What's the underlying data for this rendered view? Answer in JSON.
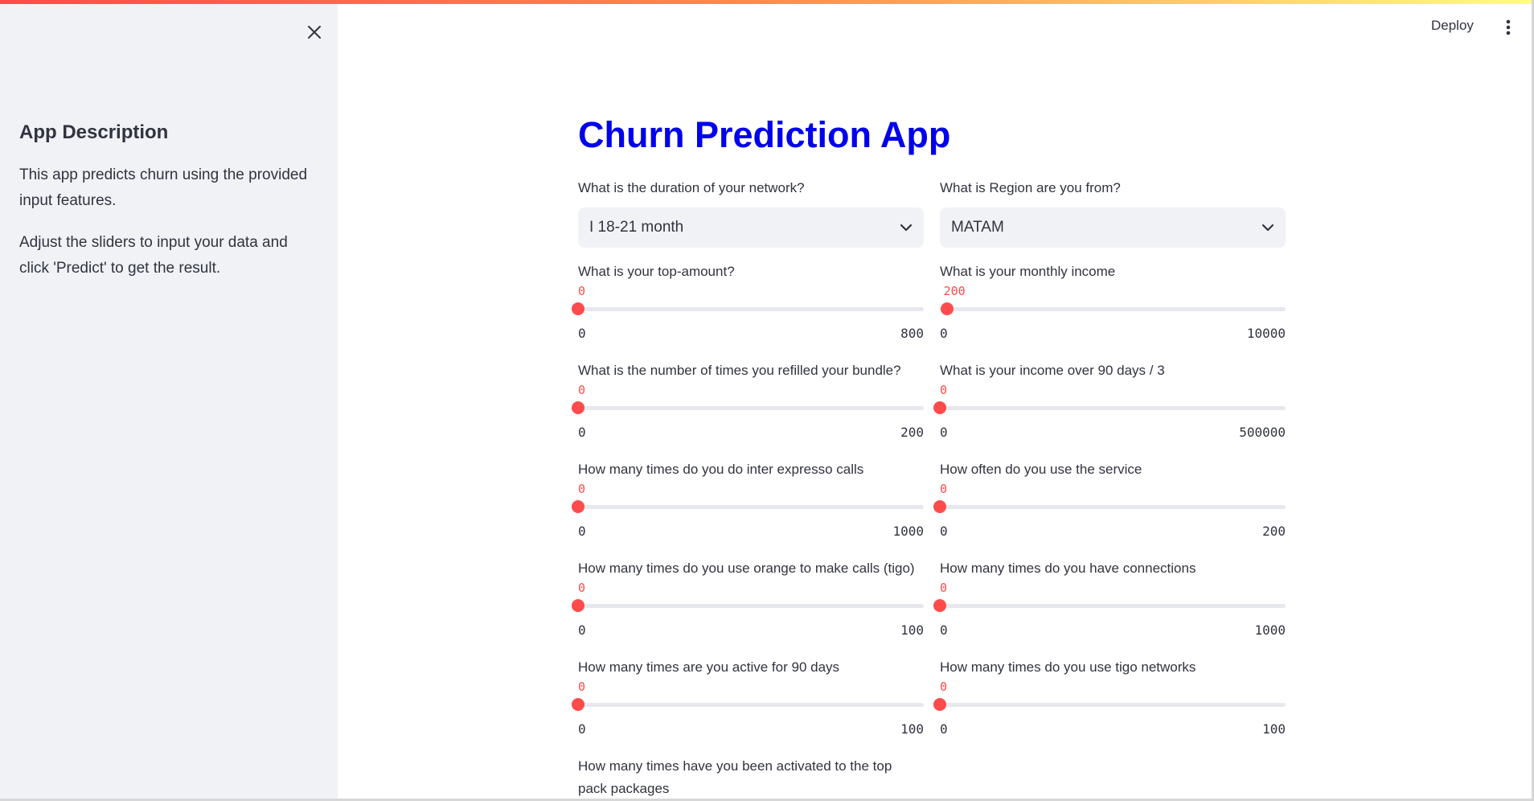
{
  "sidebar": {
    "heading": "App Description",
    "paragraph1": "This app predicts churn using the provided input features.",
    "paragraph2": "Adjust the sliders to input your data and click 'Predict' to get the result."
  },
  "header": {
    "deploy_label": "Deploy"
  },
  "main": {
    "title": "Churn Prediction App",
    "title_color": "#0000ee",
    "accent_color": "#ff4b4b",
    "selects": {
      "duration": {
        "label": "What is the duration of your network?",
        "value": "I 18-21 month"
      },
      "region": {
        "label": "What is Region are you from?",
        "value": "MATAM"
      }
    },
    "sliders": {
      "top_amount": {
        "label": "What is your top-amount?",
        "value": "0",
        "min": "0",
        "max": "800",
        "fraction": 0
      },
      "monthly_income": {
        "label": "What is your monthly income",
        "value": "200",
        "min": "0",
        "max": "10000",
        "fraction": 0.02
      },
      "refill": {
        "label": "What is the number of times you refilled your bundle?",
        "value": "0",
        "min": "0",
        "max": "200",
        "fraction": 0
      },
      "income_90": {
        "label": "What is your income over 90 days / 3",
        "value": "0",
        "min": "0",
        "max": "500000",
        "fraction": 0
      },
      "inter_expresso": {
        "label": "How many times do you do inter expresso calls",
        "value": "0",
        "min": "0",
        "max": "1000",
        "fraction": 0
      },
      "service_use": {
        "label": "How often do you use the service",
        "value": "0",
        "min": "0",
        "max": "200",
        "fraction": 0
      },
      "orange_calls": {
        "label": "How many times do you use orange to make calls (tigo)",
        "value": "0",
        "min": "0",
        "max": "100",
        "fraction": 0
      },
      "connections": {
        "label": "How many times do you have connections",
        "value": "0",
        "min": "0",
        "max": "1000",
        "fraction": 0
      },
      "active_90": {
        "label": "How many times are you active for 90 days",
        "value": "0",
        "min": "0",
        "max": "100",
        "fraction": 0
      },
      "tigo_networks": {
        "label": "How many times do you use tigo networks",
        "value": "0",
        "min": "0",
        "max": "100",
        "fraction": 0
      },
      "top_pack": {
        "label": "How many times have you been activated to the top pack packages"
      }
    }
  }
}
